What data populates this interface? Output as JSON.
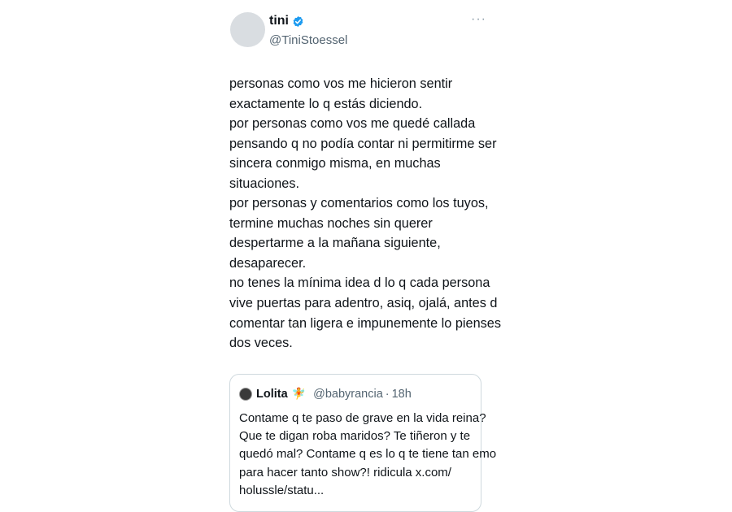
{
  "tweet": {
    "name": "tini",
    "handle": "@TiniStoessel",
    "more_icon": "more-horizontal-icon",
    "verified_color": "#1d9bf0",
    "lines": [
      "personas como vos me hicieron sentir",
      "exactamente lo q estás diciendo.",
      "por personas como vos me quedé callada",
      "pensando q no podía contar ni permitirme ser",
      "sincera conmigo misma, en muchas",
      "situaciones.",
      "por personas y comentarios como los tuyos,",
      "termine muchas noches sin querer",
      "despertarme a la mañana siguiente,",
      "desaparecer.",
      "no tenes la mínima idea d lo q cada persona",
      "vive puertas para adentro, asiq, ojalá, antes d",
      "comentar tan ligera e impunemente lo pienses",
      "dos veces."
    ]
  },
  "quote": {
    "name": "Lolita",
    "emoji": "🧚",
    "handle": "@babyrancia",
    "separator": "·",
    "time": "18h",
    "lines": [
      "Contame q te paso de grave en la vida reina?",
      "Que te digan roba maridos? Te tiñeron y te",
      "quedó mal? Contame q es lo q te tiene tan emo",
      "para hacer tanto show?! ridicula x.com/",
      "holussle/statu..."
    ]
  }
}
